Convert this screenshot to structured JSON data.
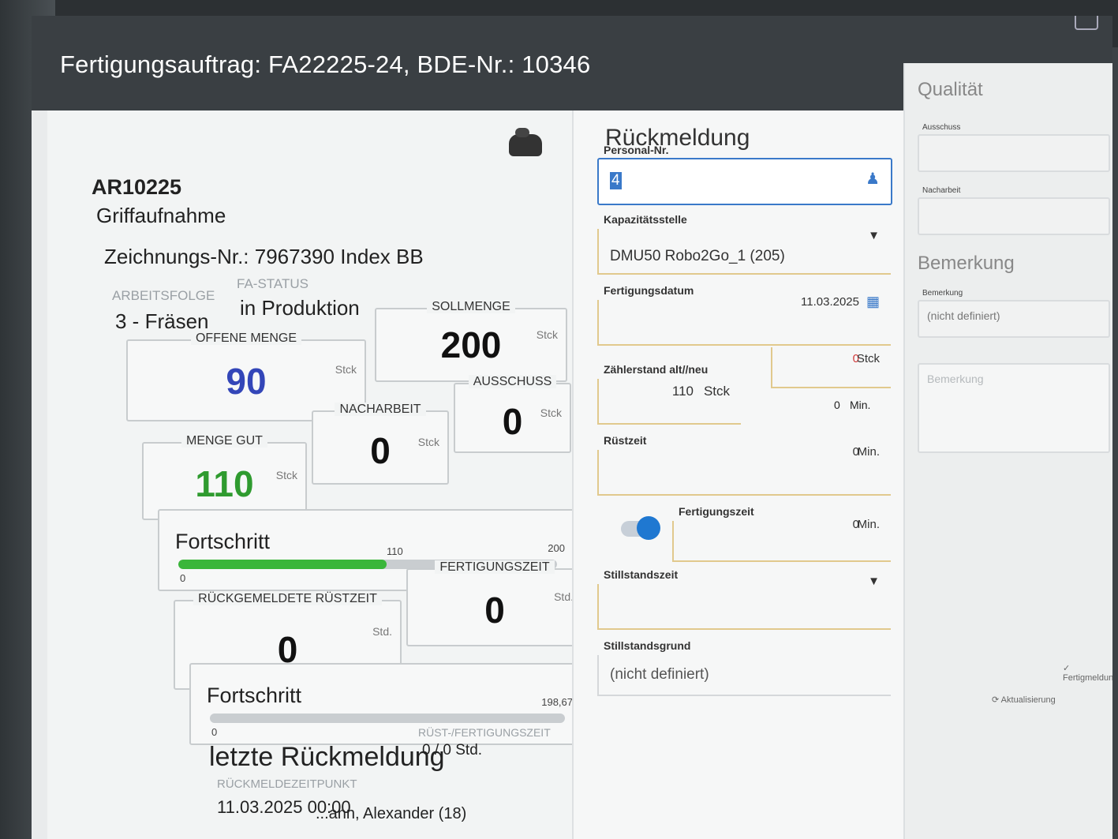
{
  "header": {
    "title": "Fertigungsauftrag: FA22225-24, BDE-Nr.: 10346"
  },
  "article": {
    "number": "AR10225",
    "name": "Griffaufnahme",
    "drawing": "Zeichnungs-Nr.: 7967390 Index BB",
    "arbeitsfolge_label": "ARBEITSFOLGE",
    "arbeitsfolge_value": "3 - Fräsen",
    "fa_status_label": "FA-STATUS",
    "fa_status_value": "in Produktion"
  },
  "quantities": {
    "offene_menge": {
      "label": "OFFENE MENGE",
      "value": "90",
      "unit": "Stck"
    },
    "sollmenge": {
      "label": "SOLLMENGE",
      "value": "200",
      "unit": "Stck"
    },
    "menge_gut": {
      "label": "MENGE GUT",
      "value": "110",
      "unit": "Stck"
    },
    "nacharbeit": {
      "label": "NACHARBEIT",
      "value": "0",
      "unit": "Stck"
    },
    "ausschuss": {
      "label": "AUSSCHUSS",
      "value": "0",
      "unit": "Stck"
    }
  },
  "progress_qty": {
    "title": "Fortschritt",
    "min": "0",
    "current": "110",
    "max": "200",
    "fraction": 0.55
  },
  "times": {
    "ruestzeit": {
      "label": "RÜCKGEMELDETE RÜSTZEIT",
      "value": "0",
      "unit": "Std."
    },
    "fertigungszeit": {
      "label": "FERTIGUNGSZEIT",
      "value": "0",
      "unit": "Std."
    }
  },
  "progress_time": {
    "title": "Fortschritt",
    "min": "0",
    "max": "198,67",
    "fraction": 0.0
  },
  "last_report": {
    "title": "letzte Rückmeldung",
    "time_label": "RÜCKMELDEZEITPUNKT",
    "time_value": "11.03.2025 00:00",
    "setup_label": "RÜST-/FERTIGUNGSZEIT",
    "setup_value": "0 / 0 Std.",
    "person": "...ann, Alexander (18)"
  },
  "rueckmeldung": {
    "heading": "Rückmeldung",
    "personal_label": "Personal-Nr.",
    "personal_value": "4",
    "kapazitaet_label": "Kapazitätsstelle",
    "kapazitaet_value": "DMU50 Robo2Go_1 (205)",
    "datum_label": "Fertigungsdatum",
    "datum_value": "11.03.2025",
    "ausschuss_value": "0",
    "ausschuss_unit": "Stck",
    "zaehler_label": "Zählerstand alt//neu",
    "zaehler_value": "110",
    "zaehler_unit": "Stck",
    "ruest_top_value": "0",
    "ruest_top_unit": "Min.",
    "ruestzeit_label": "Rüstzeit",
    "ruestzeit_value": "0",
    "ruestzeit_unit": "Min.",
    "fertigungszeit_label": "Fertigungszeit",
    "fertigungszeit_value": "0",
    "fertigungszeit_unit": "Min.",
    "stillstand_label": "Stillstandszeit",
    "stillgrund_label": "Stillstandsgrund",
    "stillgrund_value": "(nicht definiert)"
  },
  "quality": {
    "heading": "Qualität",
    "ausschuss_label": "Ausschuss",
    "nacharbeit_label": "Nacharbeit",
    "bemerkung_heading": "Bemerkung",
    "bemerkung_label": "Bemerkung",
    "bemerkung_value": "(nicht definiert)",
    "bemerkung_placeholder": "Bemerkung"
  },
  "footer": {
    "refresh_label": "Aktualisierung",
    "confirm_label": "Fertigmeldung"
  }
}
